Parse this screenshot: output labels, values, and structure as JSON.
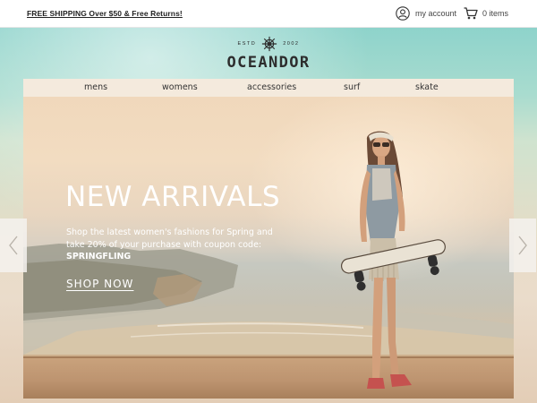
{
  "topbar": {
    "shipping": "FREE SHIPPING Over $50 & Free Returns!",
    "account_label": "my account",
    "account_icon": "user-icon",
    "cart_label": "0 items",
    "cart_icon": "cart-icon"
  },
  "logo": {
    "estd": "ESTD",
    "year": "2002",
    "emblem_icon": "ship-wheel-icon",
    "brand": "OCEANDOR"
  },
  "nav": {
    "items": [
      {
        "label": "mens"
      },
      {
        "label": "womens"
      },
      {
        "label": "accessories"
      },
      {
        "label": "surf"
      },
      {
        "label": "skate"
      }
    ]
  },
  "hero": {
    "title": "NEW ARRIVALS",
    "text_line1": "Shop the latest women's fashions for Spring and",
    "text_line2": "take 20% of your purchase with coupon code:",
    "coupon_code": "SPRINGFLING",
    "cta": "SHOP NOW"
  },
  "carousel": {
    "prev_icon": "chevron-left-icon",
    "next_icon": "chevron-right-icon"
  },
  "colors": {
    "sky": "#8ed3cb",
    "sand": "#eadccb",
    "text_dark": "#222222",
    "text_light": "#ffffff"
  }
}
